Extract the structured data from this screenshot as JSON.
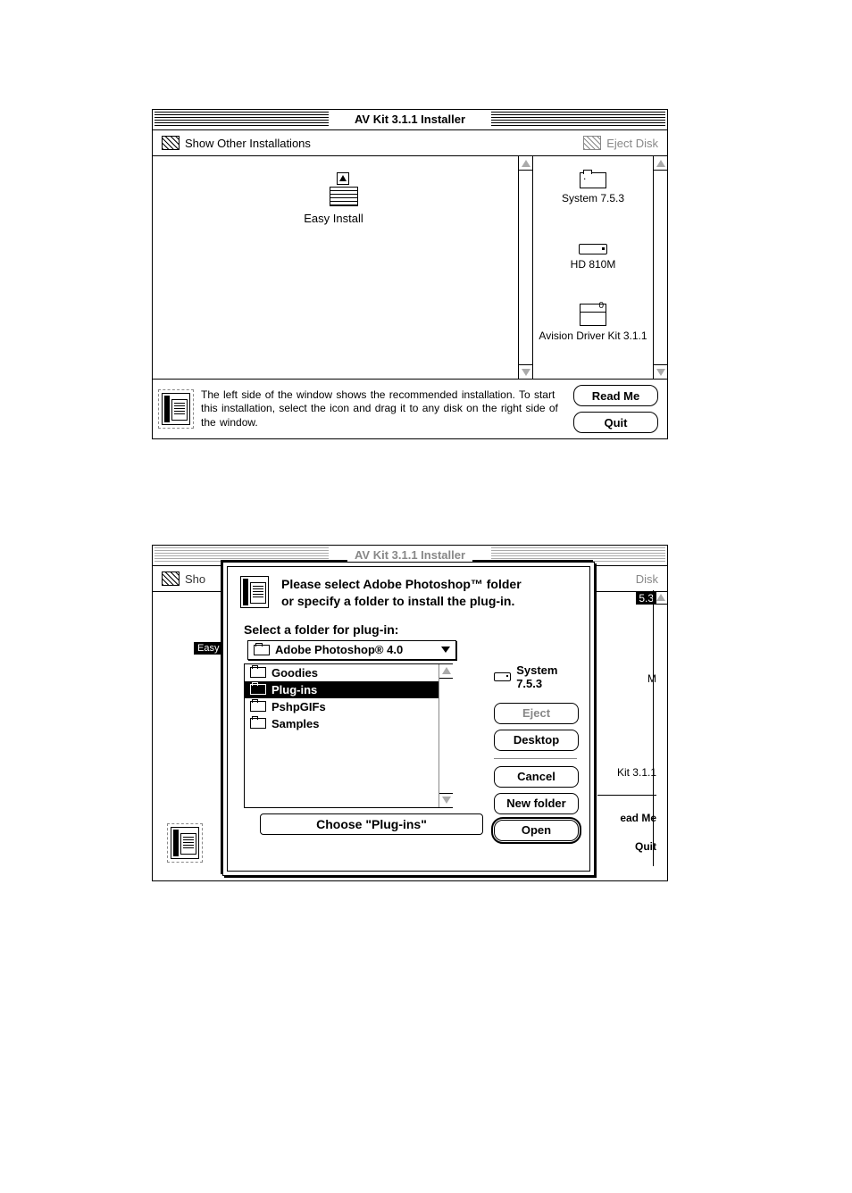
{
  "screen1": {
    "title": "AV Kit 3.1.1 Installer",
    "options": {
      "left": "Show Other Installations",
      "right": "Eject Disk"
    },
    "left_icon_label": "Easy Install",
    "drives": [
      {
        "label": "System 7.5.3"
      },
      {
        "label": "HD 810M"
      },
      {
        "label": "Avision Driver Kit 3.1.1"
      }
    ],
    "info": "The left side of the window shows the recommended installation. To start this installation, select the icon and drag it to any disk on the right side of the window.",
    "buttons": {
      "readme": "Read Me",
      "quit": "Quit"
    }
  },
  "screen2": {
    "title": "AV Kit 3.1.1 Installer",
    "options_left_short": "Sho",
    "options_right_short": "Disk",
    "easy_tag": "Easy",
    "right_col": {
      "tag": "5.3",
      "l1": "M",
      "l2": "Kit 3.1.1",
      "readme": "ead Me",
      "quit": "Quit"
    },
    "dialog": {
      "header1": "Please select Adobe Photoshop™ folder",
      "header2": "or specify a folder to install the plug-in.",
      "section": "Select a folder for plug-in:",
      "popup": "Adobe Photoshop® 4.0",
      "list": [
        {
          "name": "Goodies",
          "selected": false
        },
        {
          "name": "Plug-ins",
          "selected": true
        },
        {
          "name": "PshpGIFs",
          "selected": false
        },
        {
          "name": "Samples",
          "selected": false
        }
      ],
      "choose_btn": "Choose \"Plug-ins\"",
      "sys_label": "System 7.5.3",
      "btn_eject": "Eject",
      "btn_desktop": "Desktop",
      "btn_cancel": "Cancel",
      "btn_newfolder": "New folder",
      "btn_open": "Open"
    }
  }
}
